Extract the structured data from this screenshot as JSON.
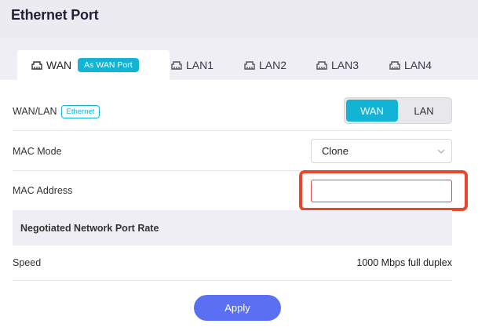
{
  "page": {
    "title": "Ethernet Port"
  },
  "tabs": [
    {
      "label": "WAN",
      "badge": "As WAN Port",
      "active": true
    },
    {
      "label": "LAN1"
    },
    {
      "label": "LAN2"
    },
    {
      "label": "LAN3"
    },
    {
      "label": "LAN4"
    }
  ],
  "wanlan": {
    "label": "WAN/LAN",
    "badge": "Ethernet",
    "options": [
      "WAN",
      "LAN"
    ],
    "selected": "WAN"
  },
  "mac_mode": {
    "label": "MAC Mode",
    "value": "Clone"
  },
  "mac_address": {
    "label": "MAC Address",
    "value": ""
  },
  "rate_section": {
    "title": "Negotiated Network Port Rate"
  },
  "speed": {
    "label": "Speed",
    "value": "1000 Mbps full duplex"
  },
  "apply_label": "Apply",
  "colors": {
    "accent": "#12b3d4",
    "primary_button": "#5b6ff2",
    "highlight": "#e8472e"
  }
}
